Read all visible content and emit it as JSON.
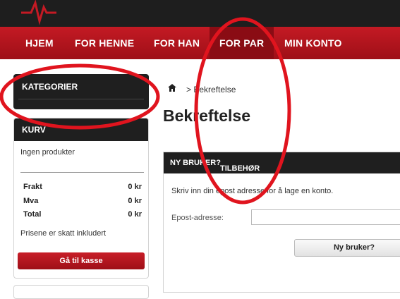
{
  "colors": {
    "brand": "#b3141d",
    "nav_active": "#8a0c14",
    "header_dark": "#1e1e1e",
    "annotation": "#e0141e"
  },
  "nav": {
    "items": [
      {
        "label": "HJEM"
      },
      {
        "label": "FOR HENNE"
      },
      {
        "label": "FOR HAN"
      },
      {
        "label": "FOR PAR",
        "active": true
      },
      {
        "label": "MIN KONTO"
      }
    ]
  },
  "sidebar": {
    "categories_title": "KATEGORIER",
    "cart": {
      "title": "KURV",
      "empty_text": "Ingen produkter",
      "rows": [
        {
          "label": "Frakt",
          "value": "0 kr"
        },
        {
          "label": "Mva",
          "value": "0 kr"
        },
        {
          "label": "Total",
          "value": "0 kr"
        }
      ],
      "tax_note": "Prisene er skatt inkludert",
      "checkout_label": "Gå til kasse"
    }
  },
  "breadcrumb": {
    "separator": ">",
    "current": "Bekreftelse",
    "home_icon": "home-icon"
  },
  "page_title": "Bekreftelse",
  "new_user_panel": {
    "title": "NY BRUKER?",
    "description": "Skriv inn din epost adresse for å lage en konto.",
    "email_label": "Epost-adresse:",
    "email_value": "",
    "button_label": "Ny bruker?"
  },
  "annotation": {
    "overlay_label": "TILBEHØR"
  }
}
